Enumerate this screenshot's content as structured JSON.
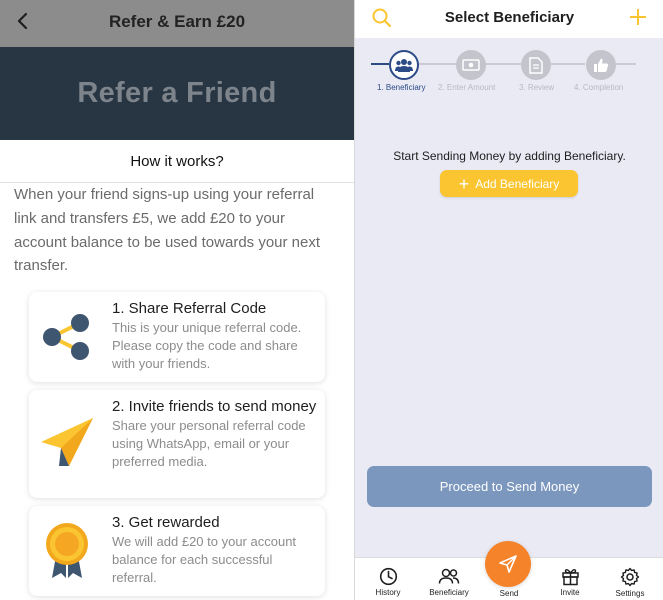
{
  "left": {
    "header_title": "Refer & Earn £20",
    "hero_title": "Refer a Friend",
    "how_it_works": "How it works?",
    "intro": "When your friend signs-up using your referral link and transfers £5, we add £20 to your account balance to be used towards your next transfer.",
    "steps": [
      {
        "title": "1. Share Referral Code",
        "description": "This is your unique referral code. Please copy the code and share with your friends.",
        "icon": "share-icon"
      },
      {
        "title": "2. Invite friends to send money",
        "description": "Share your personal referral code using WhatsApp, email or your preferred media.",
        "icon": "paper-plane-icon"
      },
      {
        "title": "3. Get rewarded",
        "description": "We will add £20 to your account balance for each successful referral.",
        "icon": "reward-badge-icon"
      }
    ]
  },
  "right": {
    "header_title": "Select Beneficiary",
    "stepper": [
      {
        "label": "1. Beneficiary",
        "icon": "users-icon",
        "active": true
      },
      {
        "label": "2. Enter Amount",
        "icon": "banknote-icon",
        "active": false
      },
      {
        "label": "3. Review",
        "icon": "document-icon",
        "active": false
      },
      {
        "label": "4. Completion",
        "icon": "thumbs-up-icon",
        "active": false
      }
    ],
    "empty_message": "Start Sending Money by adding Beneficiary.",
    "add_button": "Add Beneficiary",
    "proceed_button": "Proceed to Send Money",
    "tabs": {
      "history": "History",
      "beneficiary": "Beneficiary",
      "send": "Send",
      "invite": "Invite",
      "settings": "Settings"
    }
  },
  "colors": {
    "hero_bg": "#283644",
    "accent_yellow": "#fbc531",
    "brand_navy": "#2c4b86",
    "proceed_button": "#7b97be",
    "send_orange": "#f5832a"
  }
}
